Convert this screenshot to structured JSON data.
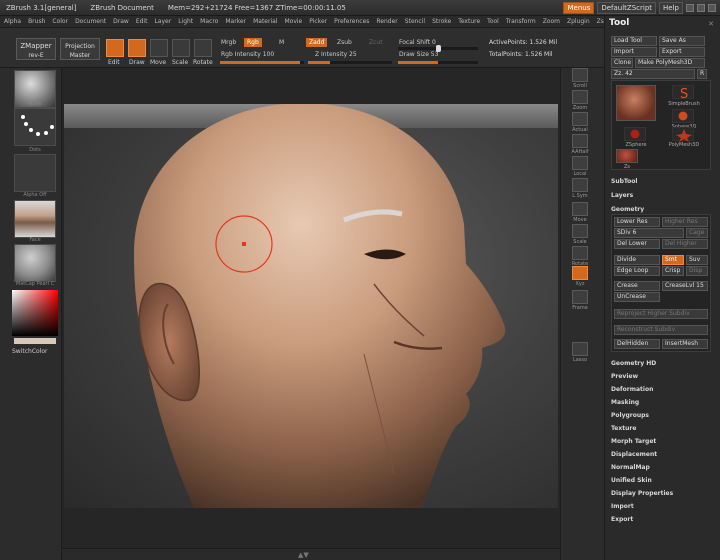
{
  "titlebar": {
    "app": "ZBrush 3.1[general]",
    "doc": "ZBrush Document",
    "mem": "Mem=292+21724 Free=1367 ZTime=00:00:11.05",
    "menus_btn": "Menus",
    "script_btn": "DefaultZScript",
    "help_btn": "Help"
  },
  "menubar": [
    "Alpha",
    "Brush",
    "Color",
    "Document",
    "Draw",
    "Edit",
    "Layer",
    "Light",
    "Macro",
    "Marker",
    "Material",
    "Movie",
    "Picker",
    "Preferences",
    "Render",
    "Stencil",
    "Stroke",
    "Texture",
    "Tool",
    "Transform",
    "Zoom",
    "Zplugin",
    "Zscript"
  ],
  "shelf": {
    "zmapper": "ZMapper",
    "zmapper_sub": "rev-E",
    "projection": "Projection",
    "projection_sub": "Master",
    "edit": "Edit",
    "draw": "Draw",
    "move": "Move",
    "scale": "Scale",
    "rotate": "Rotate",
    "mrgb": "Mrgb",
    "rgb": "Rgb",
    "m": "M",
    "rgb_intensity": "Rgb Intensity 100",
    "zadd": "Zadd",
    "zsub": "Zsub",
    "zcut": "Zcut",
    "z_intensity": "Z Intensity 25",
    "focal_shift": "Focal Shift 0",
    "draw_size": "Draw Size 53",
    "active_points": "ActivePoints: 1.526 Mil",
    "total_points": "TotalPoints: 1.526 Mil"
  },
  "leftshelf": {
    "move": "Move",
    "dots": "Dots",
    "alpha": "Alpha Off",
    "face": "Face",
    "matcap": "MatCap Pearl C",
    "switch_color": "SwitchColor"
  },
  "rightcol": [
    "Scroll",
    "Zoom",
    "Actual",
    "AAHalf",
    "Local",
    "L.Sym",
    "Move",
    "Scale",
    "Rotate",
    "Xyz",
    "Frame",
    "Lasso"
  ],
  "palette": {
    "title": "Tool",
    "load_tool": "Load Tool",
    "save_as": "Save As",
    "import": "Import",
    "export": "Export",
    "clone": "Clone",
    "make_polymesh": "Make PolyMesh3D",
    "zz": "Zz. 42",
    "r": "R",
    "simplebrush": "SimpleBrush",
    "sphere3d": "Sphere3D",
    "zsphere": "ZSphere",
    "polymesh3d": "PolyMesh3D",
    "zs": "Zs",
    "subtool": "SubTool",
    "layers": "Layers",
    "geometry": "Geometry",
    "lower_res": "Lower Res",
    "higher_res": "Higher Res",
    "sdiv": "SDiv 6",
    "cage": "Cage",
    "del_lower": "Del Lower",
    "del_higher": "Del Higher",
    "divide": "Divide",
    "smt": "Smt",
    "suv": "Suv",
    "edge_loop": "Edge Loop",
    "crisp": "Crisp",
    "disp": "Disp",
    "crease": "Crease",
    "creaselvl": "CreaseLvl 15",
    "uncrease": "UnCrease",
    "reproject": "Reproject Higher Subdiv",
    "reconstruct": "Reconstruct Subdiv",
    "delhidden": "DelHidden",
    "inserthesh": "InsertMesh",
    "sections": [
      "Geometry HD",
      "Preview",
      "Deformation",
      "Masking",
      "Polygroups",
      "Texture",
      "Morph Target",
      "Displacement",
      "NormalMap",
      "Unified Skin",
      "Display Properties",
      "Import",
      "Export"
    ]
  },
  "colors": {
    "accent": "#d2691e",
    "panel": "#2a2a2a",
    "canvas": "#3f3f3f"
  }
}
